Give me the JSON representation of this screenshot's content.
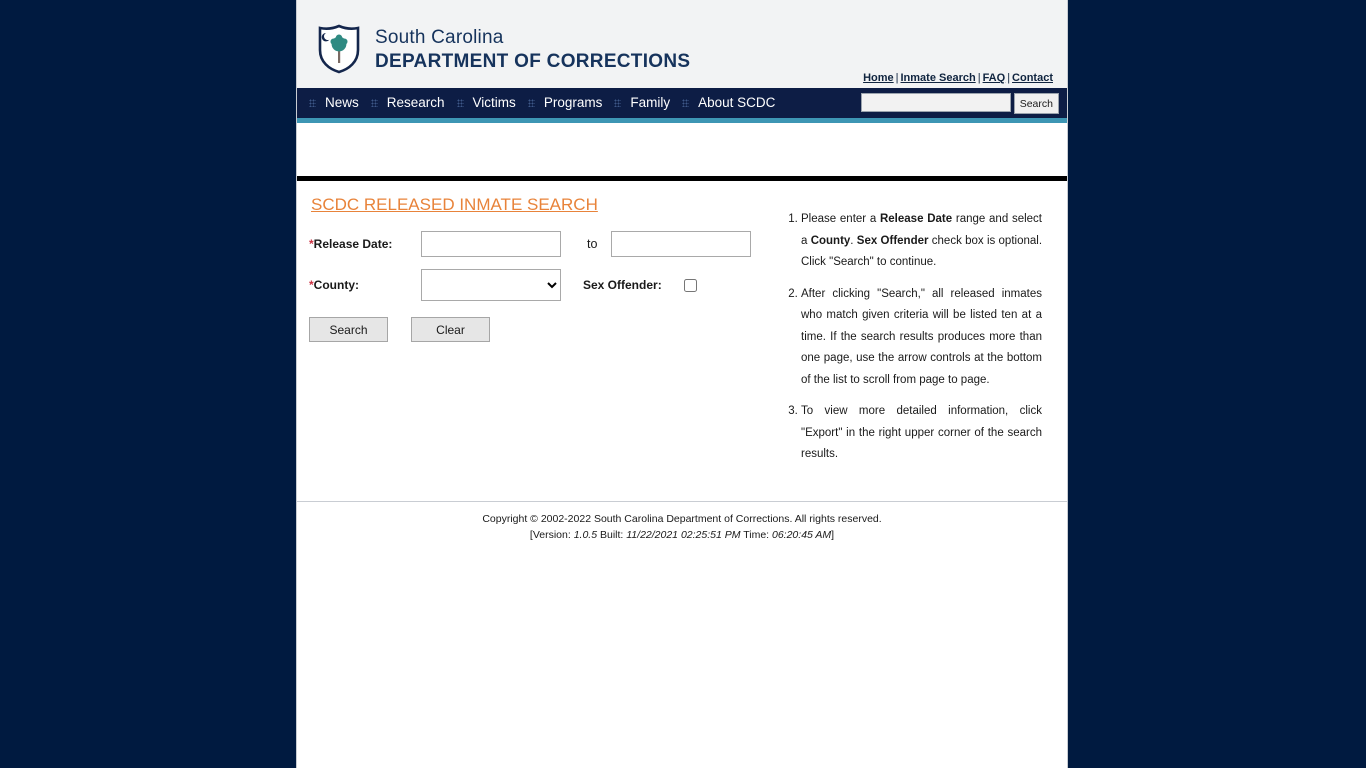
{
  "header": {
    "brand_line1": "South Carolina",
    "brand_line2": "DEPARTMENT OF CORRECTIONS",
    "logo_icon": "shield-palmetto-icon",
    "toplinks": [
      {
        "label": "Home"
      },
      {
        "label": "Inmate Search"
      },
      {
        "label": "FAQ"
      },
      {
        "label": "Contact"
      }
    ],
    "toplink_separator": "|"
  },
  "nav": {
    "items": [
      {
        "label": "News",
        "icon": "dot-grid-icon"
      },
      {
        "label": "Research",
        "icon": "dot-grid-icon"
      },
      {
        "label": "Victims",
        "icon": "dot-grid-icon"
      },
      {
        "label": "Programs",
        "icon": "dot-grid-icon"
      },
      {
        "label": "Family",
        "icon": "dot-grid-icon"
      },
      {
        "label": "About SCDC",
        "icon": "dot-grid-icon"
      }
    ],
    "search": {
      "value": "",
      "placeholder": "",
      "button_label": "Search"
    }
  },
  "main": {
    "page_title": "SCDC RELEASED INMATE SEARCH",
    "form": {
      "release_date_label": "Release Date:",
      "release_date_required": "*",
      "release_date_from_value": "",
      "release_date_from_placeholder": "",
      "to_label": "to",
      "release_date_to_value": "",
      "release_date_to_placeholder": "",
      "county_label": "County:",
      "county_required": "*",
      "county_selected": "",
      "county_options": [
        ""
      ],
      "sex_offender_label": "Sex Offender:",
      "sex_offender_checked": false,
      "search_button": "Search",
      "clear_button": "Clear"
    },
    "instructions": [
      {
        "parts": [
          {
            "t": "Please enter a "
          },
          {
            "t": "Release Date",
            "b": true
          },
          {
            "t": " range and select a "
          },
          {
            "t": "County",
            "b": true
          },
          {
            "t": ". "
          },
          {
            "t": "Sex Offender",
            "b": true
          },
          {
            "t": " check box is optional. Click \"Search\" to continue."
          }
        ]
      },
      {
        "parts": [
          {
            "t": "After clicking \"Search,\" all released inmates who match given criteria will be listed ten at a time. If the search results produces more than one page, use the arrow controls at the bottom of the list to scroll from page to page."
          }
        ]
      },
      {
        "parts": [
          {
            "t": "To view more detailed information, click \"Export\" in the right upper corner of the search results."
          }
        ]
      }
    ]
  },
  "footer": {
    "copyright": "Copyright © 2002-2022 South Carolina Department of Corrections. All rights reserved.",
    "version_prefix": "[Version: ",
    "version": "1.0.5",
    "built_label": " Built: ",
    "built": "11/22/2021 02:25:51 PM",
    "time_label": " Time: ",
    "time": "06:20:45 AM",
    "version_suffix": "]"
  },
  "colors": {
    "navy": "#0d1d45",
    "teal_accent": "#3d96b4",
    "title_orange": "#e8833a",
    "required_red": "#cc3344",
    "page_background": "#001a40"
  }
}
